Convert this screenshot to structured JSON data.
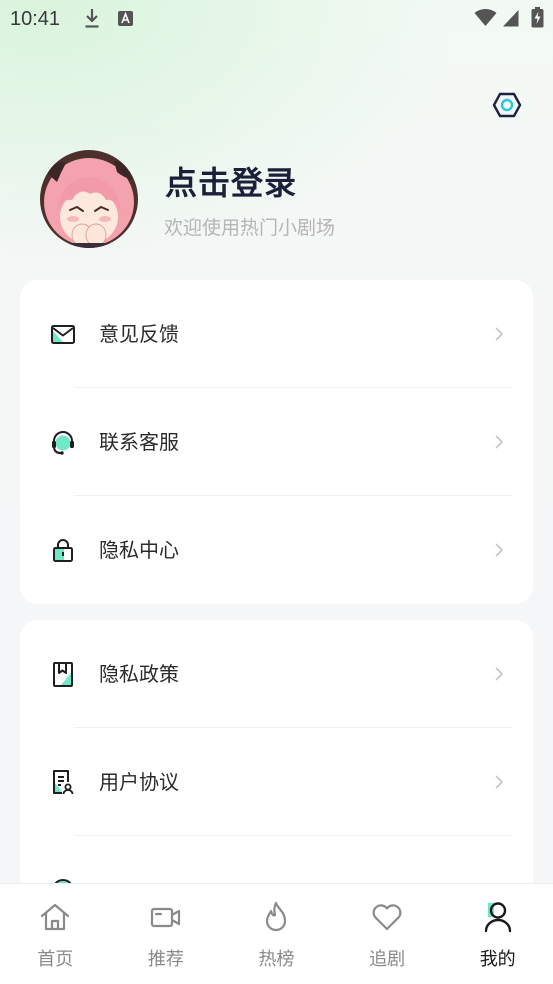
{
  "status_bar": {
    "time": "10:41",
    "left_icons": [
      "download-icon",
      "input-method-icon"
    ],
    "right_icons": [
      "wifi-icon",
      "signal-icon",
      "battery-charging-icon"
    ]
  },
  "header": {
    "settings_icon": "settings-hexagon-icon"
  },
  "profile": {
    "avatar": "anime-avatar-image",
    "title": "点击登录",
    "subtitle": "欢迎使用热门小剧场"
  },
  "menu_groups": [
    {
      "items": [
        {
          "label": "意见反馈",
          "icon": "mail-icon"
        },
        {
          "label": "联系客服",
          "icon": "headset-icon"
        },
        {
          "label": "隐私中心",
          "icon": "lock-icon"
        }
      ]
    },
    {
      "items": [
        {
          "label": "隐私政策",
          "icon": "bookmark-document-icon"
        },
        {
          "label": "用户协议",
          "icon": "user-agreement-icon"
        },
        {
          "icon": "circle-icon"
        }
      ]
    }
  ],
  "row_chevron_icon": "chevron-right-icon",
  "bottom_nav": {
    "items": [
      {
        "label": "首页",
        "icon": "home-icon",
        "active": false
      },
      {
        "label": "推荐",
        "icon": "video-icon",
        "active": false
      },
      {
        "label": "热榜",
        "icon": "flame-icon",
        "active": false
      },
      {
        "label": "追剧",
        "icon": "heart-icon",
        "active": false
      },
      {
        "label": "我的",
        "icon": "person-icon",
        "active": true
      }
    ]
  },
  "colors": {
    "accent": "#6fe8c8",
    "title": "#1b1f3a",
    "nav_active": "#1a1a1a",
    "nav_inactive": "#8a8a8a",
    "secondary_text": "#b5b5b5"
  }
}
